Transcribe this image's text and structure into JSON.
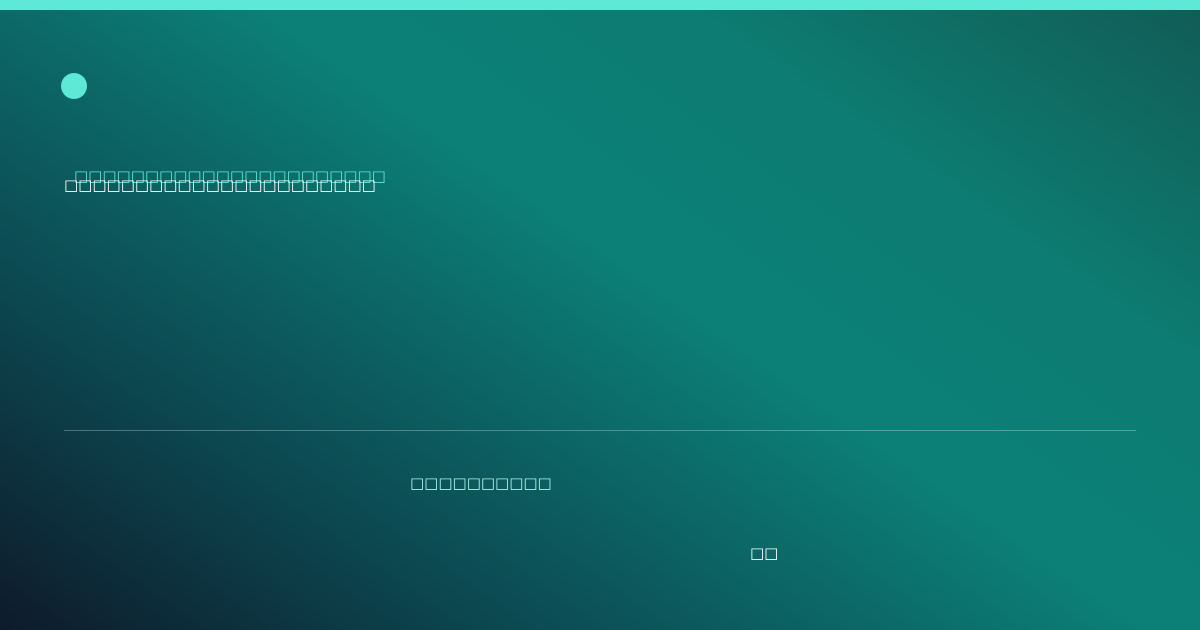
{
  "card": {
    "headline_accent": "□□□□□□□□□□□□□□□□□□□□□□",
    "headline_main": "□□□□□□□□□□□□□□□□□□□□□□",
    "footer_text": "□□□□□□□□□□",
    "footer_small": "□□"
  },
  "colors": {
    "accent": "#5ee8d6",
    "text": "#ffffff",
    "footer_text": "#a9f5e9"
  },
  "icons": {
    "logo": "circle-logo-icon"
  }
}
